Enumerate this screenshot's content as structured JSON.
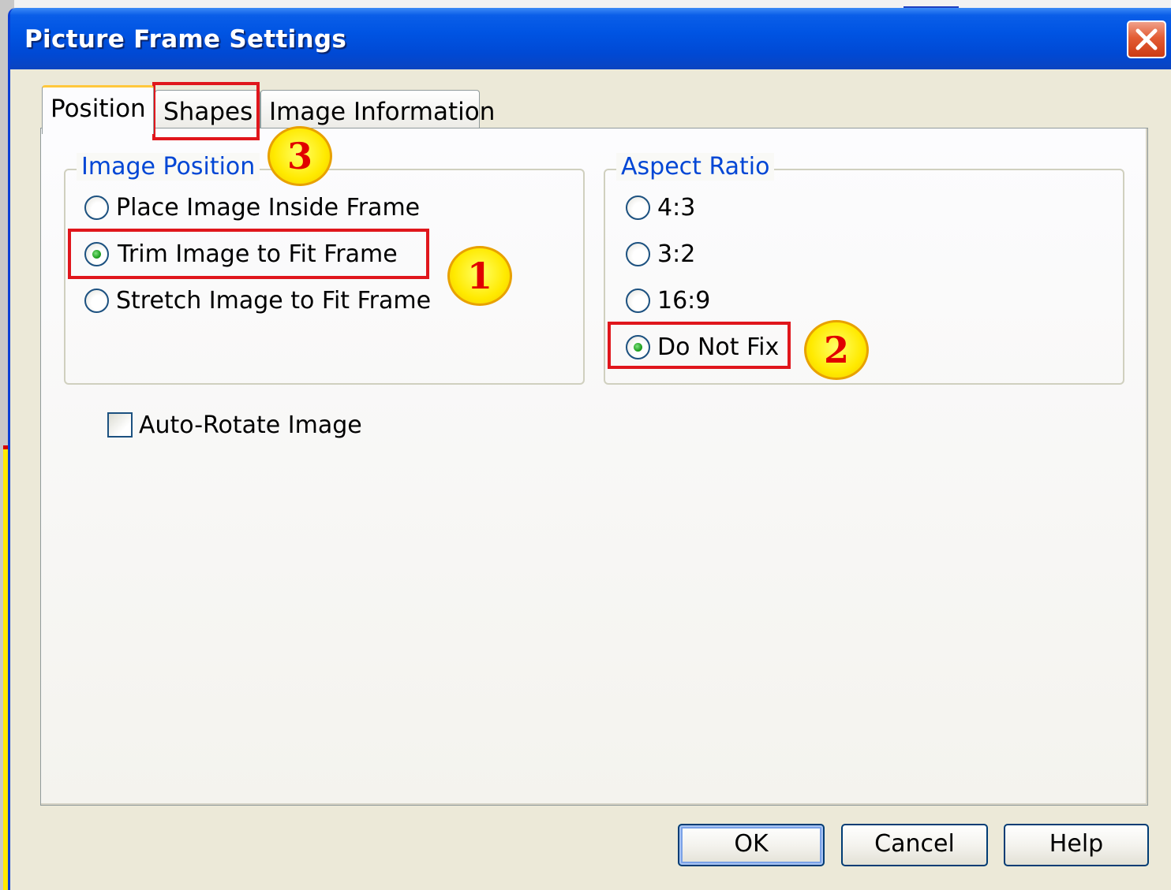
{
  "dialog": {
    "title": "Picture Frame Settings"
  },
  "tabs": [
    {
      "label": "Position",
      "selected": true
    },
    {
      "label": "Shapes",
      "selected": false
    },
    {
      "label": "Image Information",
      "selected": false
    }
  ],
  "image_position": {
    "label": "Image Position",
    "options": [
      {
        "label": "Place Image Inside Frame",
        "checked": false
      },
      {
        "label": "Trim Image to Fit Frame",
        "checked": true
      },
      {
        "label": "Stretch Image to Fit Frame",
        "checked": false
      }
    ]
  },
  "aspect_ratio": {
    "label": "Aspect Ratio",
    "options": [
      {
        "label": "4:3",
        "checked": false
      },
      {
        "label": "3:2",
        "checked": false
      },
      {
        "label": "16:9",
        "checked": false
      },
      {
        "label": "Do Not Fix",
        "checked": true
      }
    ]
  },
  "auto_rotate": {
    "label": "Auto-Rotate Image",
    "checked": false
  },
  "annotations": {
    "step1": "1",
    "step2": "2",
    "step3": "3"
  },
  "buttons": {
    "ok": "OK",
    "cancel": "Cancel",
    "help": "Help"
  },
  "colors": {
    "titlebar": "#0054e3",
    "dialog_bg": "#ece9d8",
    "group_label": "#0046d5",
    "annotation_box": "#e0161c",
    "badge_fill": "#ffea00"
  },
  "icons": {
    "close": "close-icon"
  }
}
